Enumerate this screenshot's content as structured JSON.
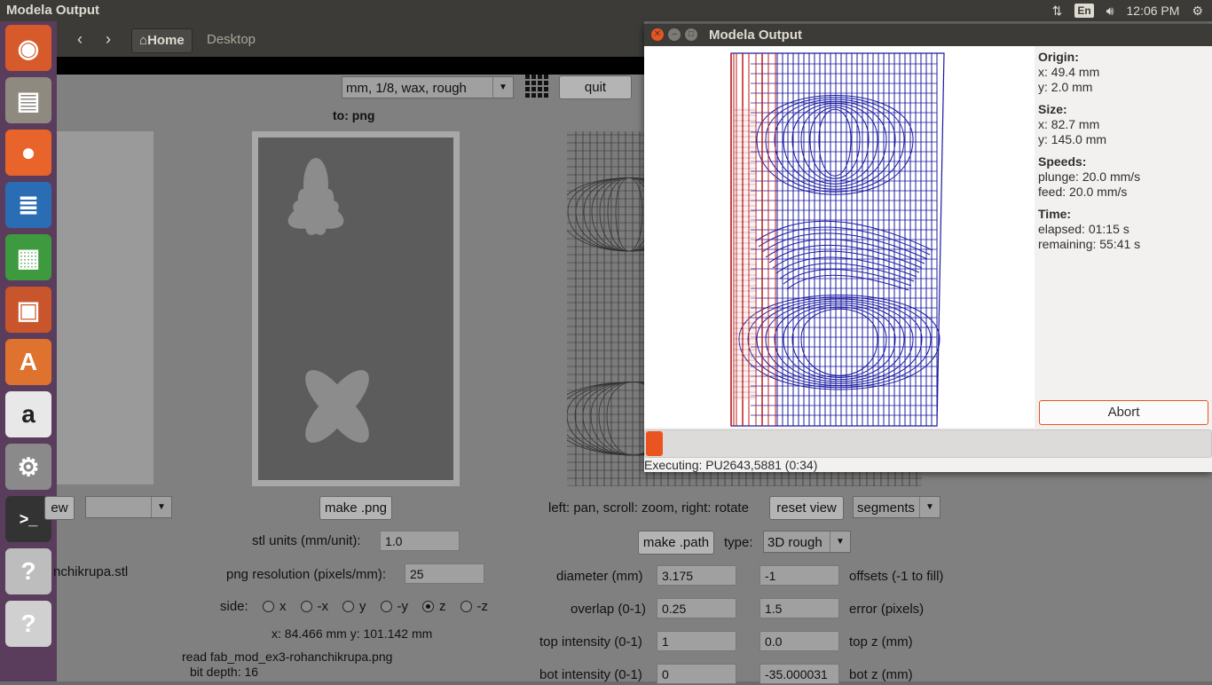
{
  "topbar": {
    "title": "Modela Output",
    "lang": "En",
    "clock": "12:06 PM"
  },
  "launcher": {
    "items": [
      {
        "name": "ubuntu-dash-icon",
        "color": "#d65a2a",
        "glyph": "◉"
      },
      {
        "name": "files-icon",
        "color": "#8f8a80",
        "glyph": "▤"
      },
      {
        "name": "firefox-icon",
        "color": "#e8642b",
        "glyph": "●"
      },
      {
        "name": "writer-icon",
        "color": "#2a6db5",
        "glyph": "≣"
      },
      {
        "name": "calc-icon",
        "color": "#3e9a3e",
        "glyph": "▦"
      },
      {
        "name": "impress-icon",
        "color": "#c8552b",
        "glyph": "▣"
      },
      {
        "name": "software-center-icon",
        "color": "#e0722f",
        "glyph": "A"
      },
      {
        "name": "amazon-icon",
        "color": "#e8e8e8",
        "glyph": "a"
      },
      {
        "name": "settings-icon",
        "color": "#8a8a8a",
        "glyph": "⚙"
      },
      {
        "name": "terminal-icon",
        "color": "#333333",
        "glyph": ">_"
      },
      {
        "name": "unknown-app-icon",
        "color": "#bdbdbd",
        "glyph": "?"
      },
      {
        "name": "unknown-app-icon",
        "color": "#d0d0d0",
        "glyph": "?"
      }
    ]
  },
  "nautilus": {
    "home": "Home",
    "desktop": "Desktop"
  },
  "app": {
    "process_select": "mm, 1/8, wax, rough",
    "quit": "quit",
    "to_label": "to: png",
    "left_combo_btn": "ew",
    "left_combo_value": "",
    "make_png": "make .png",
    "stl_units_label": "stl units (mm/unit):",
    "stl_units_value": "1.0",
    "filename_partial": "nchikrupa.stl",
    "png_res_label": "png resolution (pixels/mm):",
    "png_res_value": "25",
    "side_label": "side:",
    "sides": [
      "x",
      "-x",
      "y",
      "-y",
      "z",
      "-z"
    ],
    "side_selected": "z",
    "dims": "x: 84.466 mm  y: 101.142 mm",
    "read_line": "read fab_mod_ex3-rohanchikrupa.png",
    "bit_depth": "bit depth: 16",
    "view_hint": "left: pan, scroll: zoom, right: rotate",
    "reset_view": "reset view",
    "segments": "segments",
    "make_path": "make .path",
    "type_label": "type:",
    "type_value": "3D rough",
    "diameter_label": "diameter (mm)",
    "diameter_value": "3.175",
    "offsets_value": "-1",
    "offsets_label": "offsets (-1 to fill)",
    "overlap_label": "overlap (0-1)",
    "overlap_value": "0.25",
    "error_value": "1.5",
    "error_label": "error (pixels)",
    "top_int_label": "top intensity (0-1)",
    "top_int_value": "1",
    "top_z_value": "0.0",
    "top_z_label": "top z (mm)",
    "bot_int_label": "bot intensity (0-1)",
    "bot_int_value": "0",
    "bot_z_value": "-35.000031",
    "bot_z_label": "bot z (mm)"
  },
  "dialog": {
    "title": "Modela Output",
    "origin_h": "Origin:",
    "origin_x": "x: 49.4 mm",
    "origin_y": "y: 2.0 mm",
    "size_h": "Size:",
    "size_x": "x: 82.7 mm",
    "size_y": "y: 145.0 mm",
    "speeds_h": "Speeds:",
    "plunge": "plunge: 20.0 mm/s",
    "feed": "feed: 20.0 mm/s",
    "time_h": "Time:",
    "elapsed": "elapsed: 01:15 s",
    "remaining": "remaining: 55:41 s",
    "abort": "Abort",
    "progress": 0.03,
    "status": "Executing: PU2643,5881 (0:34)"
  }
}
